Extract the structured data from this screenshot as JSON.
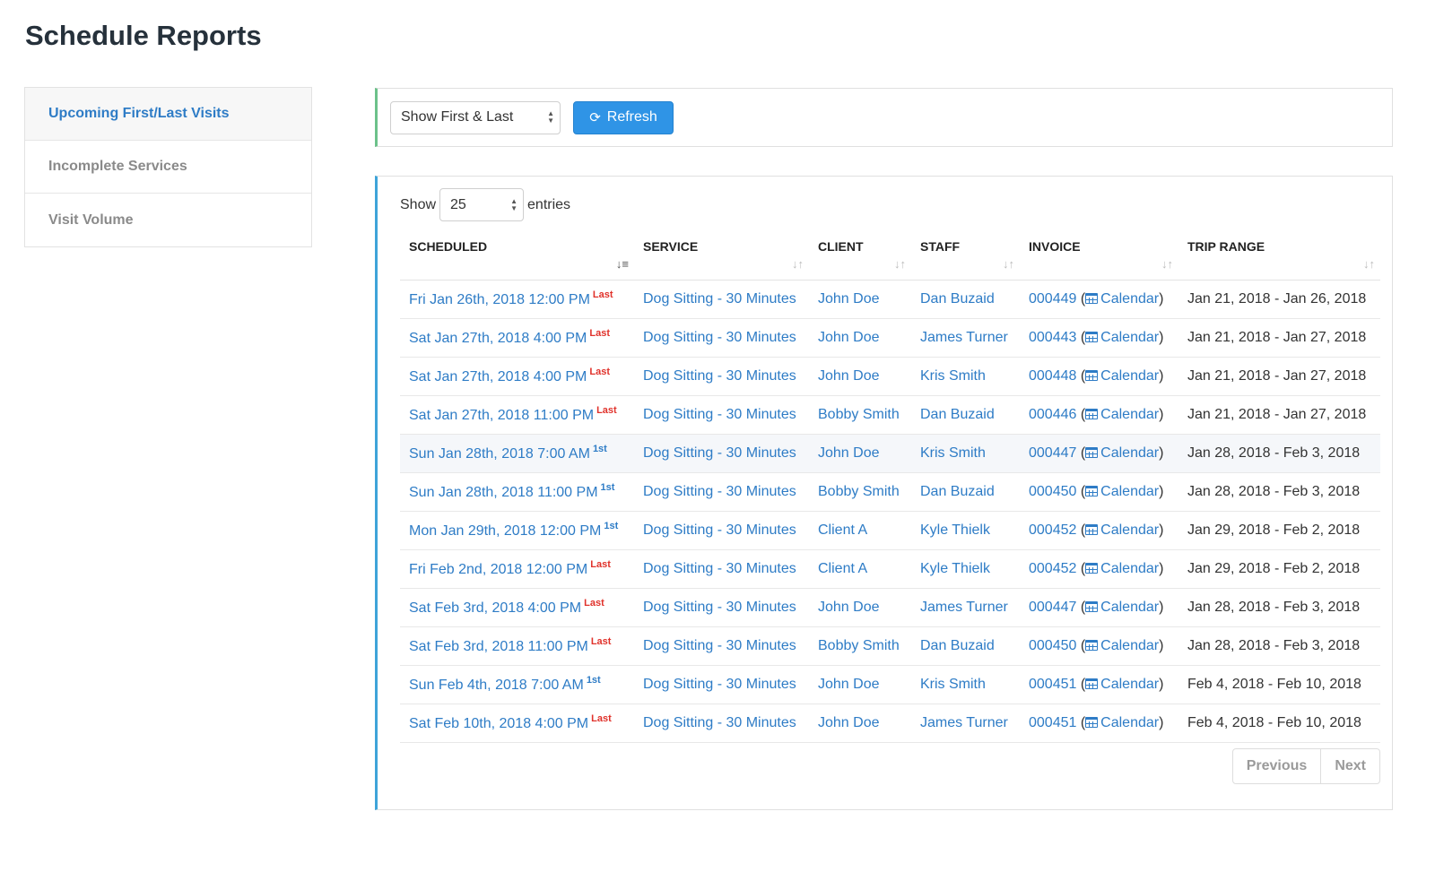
{
  "page": {
    "title": "Schedule Reports"
  },
  "sidebar": {
    "items": [
      {
        "label": "Upcoming First/Last Visits",
        "active": true
      },
      {
        "label": "Incomplete Services",
        "active": false
      },
      {
        "label": "Visit Volume",
        "active": false
      }
    ]
  },
  "filter": {
    "select_value": "Show First & Last",
    "refresh_label": "Refresh",
    "refresh_icon": "refresh-icon"
  },
  "table": {
    "show_label": "Show",
    "length_value": "25",
    "entries_label": "entries",
    "columns": [
      "SCHEDULED",
      "SERVICE",
      "CLIENT",
      "STAFF",
      "INVOICE",
      "TRIP RANGE"
    ],
    "rows": [
      {
        "scheduled": "Fri Jan 26th, 2018 12:00 PM",
        "tag": "Last",
        "service": "Dog Sitting - 30 Minutes",
        "client": "John Doe",
        "staff": "Dan Buzaid",
        "invoice": "000449",
        "calendar": "Calendar",
        "trip": "Jan 21, 2018 - Jan 26, 2018"
      },
      {
        "scheduled": "Sat Jan 27th, 2018 4:00 PM",
        "tag": "Last",
        "service": "Dog Sitting - 30 Minutes",
        "client": "John Doe",
        "staff": "James Turner",
        "invoice": "000443",
        "calendar": "Calendar",
        "trip": "Jan 21, 2018 - Jan 27, 2018"
      },
      {
        "scheduled": "Sat Jan 27th, 2018 4:00 PM",
        "tag": "Last",
        "service": "Dog Sitting - 30 Minutes",
        "client": "John Doe",
        "staff": "Kris Smith",
        "invoice": "000448",
        "calendar": "Calendar",
        "trip": "Jan 21, 2018 - Jan 27, 2018"
      },
      {
        "scheduled": "Sat Jan 27th, 2018 11:00 PM",
        "tag": "Last",
        "service": "Dog Sitting - 30 Minutes",
        "client": "Bobby Smith",
        "staff": "Dan Buzaid",
        "invoice": "000446",
        "calendar": "Calendar",
        "trip": "Jan 21, 2018 - Jan 27, 2018"
      },
      {
        "scheduled": "Sun Jan 28th, 2018 7:00 AM",
        "tag": "1st",
        "service": "Dog Sitting - 30 Minutes",
        "client": "John Doe",
        "staff": "Kris Smith",
        "invoice": "000447",
        "calendar": "Calendar",
        "trip": "Jan 28, 2018 - Feb 3, 2018",
        "highlight": true
      },
      {
        "scheduled": "Sun Jan 28th, 2018 11:00 PM",
        "tag": "1st",
        "service": "Dog Sitting - 30 Minutes",
        "client": "Bobby Smith",
        "staff": "Dan Buzaid",
        "invoice": "000450",
        "calendar": "Calendar",
        "trip": "Jan 28, 2018 - Feb 3, 2018"
      },
      {
        "scheduled": "Mon Jan 29th, 2018 12:00 PM",
        "tag": "1st",
        "service": "Dog Sitting - 30 Minutes",
        "client": "Client A",
        "staff": "Kyle Thielk",
        "invoice": "000452",
        "calendar": "Calendar",
        "trip": "Jan 29, 2018 - Feb 2, 2018"
      },
      {
        "scheduled": "Fri Feb 2nd, 2018 12:00 PM",
        "tag": "Last",
        "service": "Dog Sitting - 30 Minutes",
        "client": "Client A",
        "staff": "Kyle Thielk",
        "invoice": "000452",
        "calendar": "Calendar",
        "trip": "Jan 29, 2018 - Feb 2, 2018"
      },
      {
        "scheduled": "Sat Feb 3rd, 2018 4:00 PM",
        "tag": "Last",
        "service": "Dog Sitting - 30 Minutes",
        "client": "John Doe",
        "staff": "James Turner",
        "invoice": "000447",
        "calendar": "Calendar",
        "trip": "Jan 28, 2018 - Feb 3, 2018"
      },
      {
        "scheduled": "Sat Feb 3rd, 2018 11:00 PM",
        "tag": "Last",
        "service": "Dog Sitting - 30 Minutes",
        "client": "Bobby Smith",
        "staff": "Dan Buzaid",
        "invoice": "000450",
        "calendar": "Calendar",
        "trip": "Jan 28, 2018 - Feb 3, 2018"
      },
      {
        "scheduled": "Sun Feb 4th, 2018 7:00 AM",
        "tag": "1st",
        "service": "Dog Sitting - 30 Minutes",
        "client": "John Doe",
        "staff": "Kris Smith",
        "invoice": "000451",
        "calendar": "Calendar",
        "trip": "Feb 4, 2018 - Feb 10, 2018"
      },
      {
        "scheduled": "Sat Feb 10th, 2018 4:00 PM",
        "tag": "Last",
        "service": "Dog Sitting - 30 Minutes",
        "client": "John Doe",
        "staff": "James Turner",
        "invoice": "000451",
        "calendar": "Calendar",
        "trip": "Feb 4, 2018 - Feb 10, 2018"
      }
    ]
  },
  "pagination": {
    "previous": "Previous",
    "next": "Next"
  },
  "colors": {
    "accent_blue": "#2e7cc6",
    "button_blue": "#2f94e6",
    "last_red": "#e0322b",
    "filter_border_green": "#6cc18a"
  }
}
